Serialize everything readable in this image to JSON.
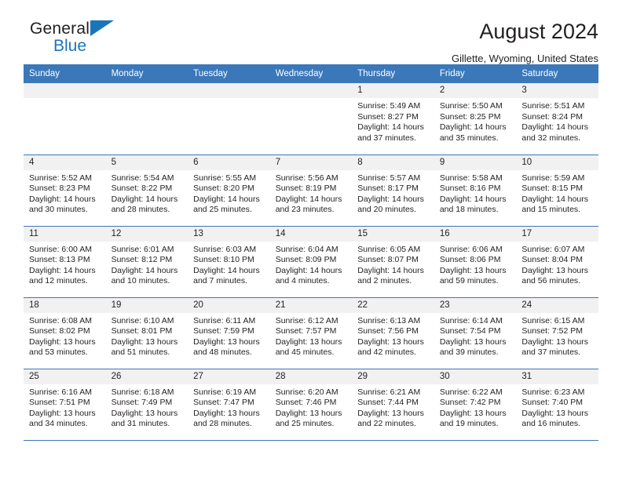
{
  "brand": {
    "name_top": "General",
    "name_bottom": "Blue",
    "triangle_color": "#1b75bb"
  },
  "header": {
    "title": "August 2024",
    "subtitle": "Gillette, Wyoming, United States"
  },
  "theme": {
    "header_bar": "#3a78ba",
    "daynum_band": "#f1f1f1",
    "text": "#231f20"
  },
  "weekday_headers": [
    "Sunday",
    "Monday",
    "Tuesday",
    "Wednesday",
    "Thursday",
    "Friday",
    "Saturday"
  ],
  "weeks": [
    [
      {
        "day": "",
        "sunrise": "",
        "sunset": "",
        "daylight": ""
      },
      {
        "day": "",
        "sunrise": "",
        "sunset": "",
        "daylight": ""
      },
      {
        "day": "",
        "sunrise": "",
        "sunset": "",
        "daylight": ""
      },
      {
        "day": "",
        "sunrise": "",
        "sunset": "",
        "daylight": ""
      },
      {
        "day": "1",
        "sunrise": "Sunrise: 5:49 AM",
        "sunset": "Sunset: 8:27 PM",
        "daylight": "Daylight: 14 hours and 37 minutes."
      },
      {
        "day": "2",
        "sunrise": "Sunrise: 5:50 AM",
        "sunset": "Sunset: 8:25 PM",
        "daylight": "Daylight: 14 hours and 35 minutes."
      },
      {
        "day": "3",
        "sunrise": "Sunrise: 5:51 AM",
        "sunset": "Sunset: 8:24 PM",
        "daylight": "Daylight: 14 hours and 32 minutes."
      }
    ],
    [
      {
        "day": "4",
        "sunrise": "Sunrise: 5:52 AM",
        "sunset": "Sunset: 8:23 PM",
        "daylight": "Daylight: 14 hours and 30 minutes."
      },
      {
        "day": "5",
        "sunrise": "Sunrise: 5:54 AM",
        "sunset": "Sunset: 8:22 PM",
        "daylight": "Daylight: 14 hours and 28 minutes."
      },
      {
        "day": "6",
        "sunrise": "Sunrise: 5:55 AM",
        "sunset": "Sunset: 8:20 PM",
        "daylight": "Daylight: 14 hours and 25 minutes."
      },
      {
        "day": "7",
        "sunrise": "Sunrise: 5:56 AM",
        "sunset": "Sunset: 8:19 PM",
        "daylight": "Daylight: 14 hours and 23 minutes."
      },
      {
        "day": "8",
        "sunrise": "Sunrise: 5:57 AM",
        "sunset": "Sunset: 8:17 PM",
        "daylight": "Daylight: 14 hours and 20 minutes."
      },
      {
        "day": "9",
        "sunrise": "Sunrise: 5:58 AM",
        "sunset": "Sunset: 8:16 PM",
        "daylight": "Daylight: 14 hours and 18 minutes."
      },
      {
        "day": "10",
        "sunrise": "Sunrise: 5:59 AM",
        "sunset": "Sunset: 8:15 PM",
        "daylight": "Daylight: 14 hours and 15 minutes."
      }
    ],
    [
      {
        "day": "11",
        "sunrise": "Sunrise: 6:00 AM",
        "sunset": "Sunset: 8:13 PM",
        "daylight": "Daylight: 14 hours and 12 minutes."
      },
      {
        "day": "12",
        "sunrise": "Sunrise: 6:01 AM",
        "sunset": "Sunset: 8:12 PM",
        "daylight": "Daylight: 14 hours and 10 minutes."
      },
      {
        "day": "13",
        "sunrise": "Sunrise: 6:03 AM",
        "sunset": "Sunset: 8:10 PM",
        "daylight": "Daylight: 14 hours and 7 minutes."
      },
      {
        "day": "14",
        "sunrise": "Sunrise: 6:04 AM",
        "sunset": "Sunset: 8:09 PM",
        "daylight": "Daylight: 14 hours and 4 minutes."
      },
      {
        "day": "15",
        "sunrise": "Sunrise: 6:05 AM",
        "sunset": "Sunset: 8:07 PM",
        "daylight": "Daylight: 14 hours and 2 minutes."
      },
      {
        "day": "16",
        "sunrise": "Sunrise: 6:06 AM",
        "sunset": "Sunset: 8:06 PM",
        "daylight": "Daylight: 13 hours and 59 minutes."
      },
      {
        "day": "17",
        "sunrise": "Sunrise: 6:07 AM",
        "sunset": "Sunset: 8:04 PM",
        "daylight": "Daylight: 13 hours and 56 minutes."
      }
    ],
    [
      {
        "day": "18",
        "sunrise": "Sunrise: 6:08 AM",
        "sunset": "Sunset: 8:02 PM",
        "daylight": "Daylight: 13 hours and 53 minutes."
      },
      {
        "day": "19",
        "sunrise": "Sunrise: 6:10 AM",
        "sunset": "Sunset: 8:01 PM",
        "daylight": "Daylight: 13 hours and 51 minutes."
      },
      {
        "day": "20",
        "sunrise": "Sunrise: 6:11 AM",
        "sunset": "Sunset: 7:59 PM",
        "daylight": "Daylight: 13 hours and 48 minutes."
      },
      {
        "day": "21",
        "sunrise": "Sunrise: 6:12 AM",
        "sunset": "Sunset: 7:57 PM",
        "daylight": "Daylight: 13 hours and 45 minutes."
      },
      {
        "day": "22",
        "sunrise": "Sunrise: 6:13 AM",
        "sunset": "Sunset: 7:56 PM",
        "daylight": "Daylight: 13 hours and 42 minutes."
      },
      {
        "day": "23",
        "sunrise": "Sunrise: 6:14 AM",
        "sunset": "Sunset: 7:54 PM",
        "daylight": "Daylight: 13 hours and 39 minutes."
      },
      {
        "day": "24",
        "sunrise": "Sunrise: 6:15 AM",
        "sunset": "Sunset: 7:52 PM",
        "daylight": "Daylight: 13 hours and 37 minutes."
      }
    ],
    [
      {
        "day": "25",
        "sunrise": "Sunrise: 6:16 AM",
        "sunset": "Sunset: 7:51 PM",
        "daylight": "Daylight: 13 hours and 34 minutes."
      },
      {
        "day": "26",
        "sunrise": "Sunrise: 6:18 AM",
        "sunset": "Sunset: 7:49 PM",
        "daylight": "Daylight: 13 hours and 31 minutes."
      },
      {
        "day": "27",
        "sunrise": "Sunrise: 6:19 AM",
        "sunset": "Sunset: 7:47 PM",
        "daylight": "Daylight: 13 hours and 28 minutes."
      },
      {
        "day": "28",
        "sunrise": "Sunrise: 6:20 AM",
        "sunset": "Sunset: 7:46 PM",
        "daylight": "Daylight: 13 hours and 25 minutes."
      },
      {
        "day": "29",
        "sunrise": "Sunrise: 6:21 AM",
        "sunset": "Sunset: 7:44 PM",
        "daylight": "Daylight: 13 hours and 22 minutes."
      },
      {
        "day": "30",
        "sunrise": "Sunrise: 6:22 AM",
        "sunset": "Sunset: 7:42 PM",
        "daylight": "Daylight: 13 hours and 19 minutes."
      },
      {
        "day": "31",
        "sunrise": "Sunrise: 6:23 AM",
        "sunset": "Sunset: 7:40 PM",
        "daylight": "Daylight: 13 hours and 16 minutes."
      }
    ]
  ]
}
